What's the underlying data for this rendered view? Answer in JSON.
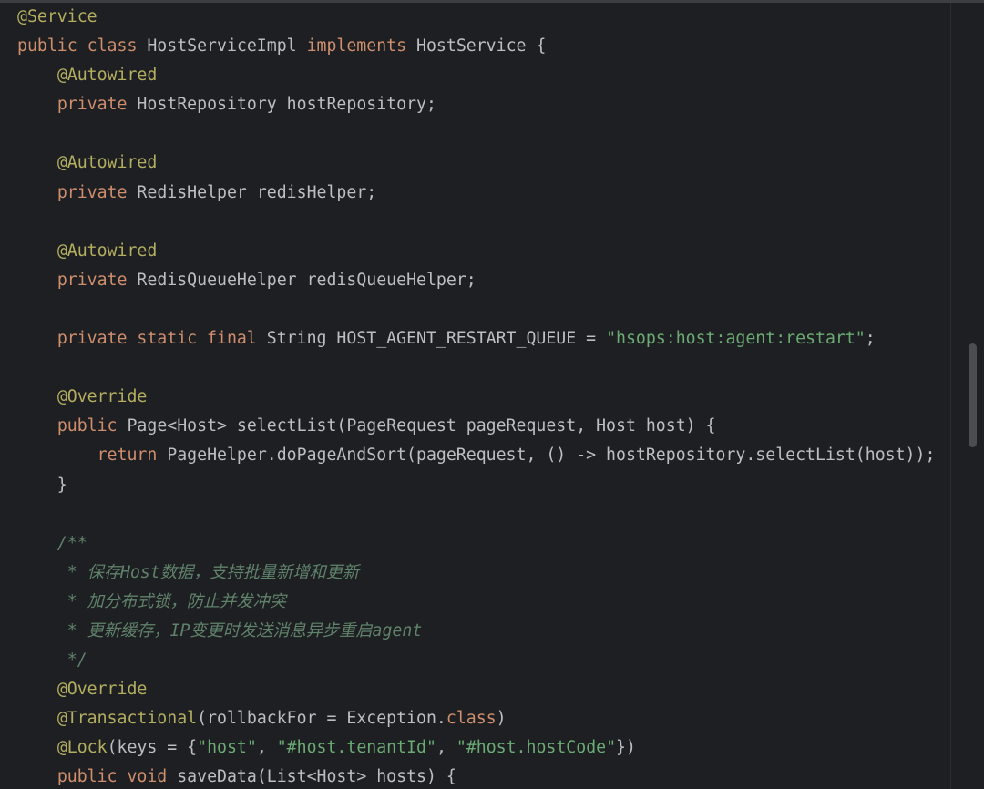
{
  "editor": {
    "lines": [
      [
        {
          "t": "ann",
          "v": "@Service"
        }
      ],
      [
        {
          "t": "kw",
          "v": "public class "
        },
        {
          "t": "plain",
          "v": "HostServiceImpl "
        },
        {
          "t": "kw",
          "v": "implements "
        },
        {
          "t": "plain",
          "v": "HostService {"
        }
      ],
      [
        {
          "t": "plain",
          "v": "    "
        },
        {
          "t": "ann",
          "v": "@Autowired"
        }
      ],
      [
        {
          "t": "plain",
          "v": "    "
        },
        {
          "t": "kw",
          "v": "private "
        },
        {
          "t": "plain",
          "v": "HostRepository hostRepository;"
        }
      ],
      [],
      [
        {
          "t": "plain",
          "v": "    "
        },
        {
          "t": "ann",
          "v": "@Autowired"
        }
      ],
      [
        {
          "t": "plain",
          "v": "    "
        },
        {
          "t": "kw",
          "v": "private "
        },
        {
          "t": "plain",
          "v": "RedisHelper redisHelper;"
        }
      ],
      [],
      [
        {
          "t": "plain",
          "v": "    "
        },
        {
          "t": "ann",
          "v": "@Autowired"
        }
      ],
      [
        {
          "t": "plain",
          "v": "    "
        },
        {
          "t": "kw",
          "v": "private "
        },
        {
          "t": "plain",
          "v": "RedisQueueHelper redisQueueHelper;"
        }
      ],
      [],
      [
        {
          "t": "plain",
          "v": "    "
        },
        {
          "t": "kw",
          "v": "private static final "
        },
        {
          "t": "plain",
          "v": "String HOST_AGENT_RESTART_QUEUE = "
        },
        {
          "t": "str",
          "v": "\"hsops:host:agent:restart\""
        },
        {
          "t": "plain",
          "v": ";"
        }
      ],
      [],
      [
        {
          "t": "plain",
          "v": "    "
        },
        {
          "t": "ann",
          "v": "@Override"
        }
      ],
      [
        {
          "t": "plain",
          "v": "    "
        },
        {
          "t": "kw",
          "v": "public "
        },
        {
          "t": "plain",
          "v": "Page<Host> selectList(PageRequest pageRequest, Host host) {"
        }
      ],
      [
        {
          "t": "plain",
          "v": "        "
        },
        {
          "t": "kw",
          "v": "return "
        },
        {
          "t": "plain",
          "v": "PageHelper.doPageAndSort(pageRequest, () -> hostRepository.selectList(host));"
        }
      ],
      [
        {
          "t": "plain",
          "v": "    }"
        }
      ],
      [],
      [
        {
          "t": "plain",
          "v": "    "
        },
        {
          "t": "doc",
          "v": "/**"
        }
      ],
      [
        {
          "t": "plain",
          "v": "     "
        },
        {
          "t": "doc",
          "v": "* 保存Host数据，支持批量新增和更新"
        }
      ],
      [
        {
          "t": "plain",
          "v": "     "
        },
        {
          "t": "doc",
          "v": "* 加分布式锁，防止并发冲突"
        }
      ],
      [
        {
          "t": "plain",
          "v": "     "
        },
        {
          "t": "doc",
          "v": "* 更新缓存，IP变更时发送消息异步重启agent"
        }
      ],
      [
        {
          "t": "plain",
          "v": "     "
        },
        {
          "t": "doc",
          "v": "*/"
        }
      ],
      [
        {
          "t": "plain",
          "v": "    "
        },
        {
          "t": "ann",
          "v": "@Override"
        }
      ],
      [
        {
          "t": "plain",
          "v": "    "
        },
        {
          "t": "ann",
          "v": "@Transactional"
        },
        {
          "t": "plain",
          "v": "(rollbackFor = Exception."
        },
        {
          "t": "kw",
          "v": "class"
        },
        {
          "t": "plain",
          "v": ")"
        }
      ],
      [
        {
          "t": "plain",
          "v": "    "
        },
        {
          "t": "ann",
          "v": "@Lock"
        },
        {
          "t": "plain",
          "v": "(keys = {"
        },
        {
          "t": "str",
          "v": "\"host\""
        },
        {
          "t": "plain",
          "v": ", "
        },
        {
          "t": "str",
          "v": "\"#host.tenantId\""
        },
        {
          "t": "plain",
          "v": ", "
        },
        {
          "t": "str",
          "v": "\"#host.hostCode\""
        },
        {
          "t": "plain",
          "v": "})"
        }
      ],
      [
        {
          "t": "plain",
          "v": "    "
        },
        {
          "t": "kw",
          "v": "public void "
        },
        {
          "t": "plain",
          "v": "saveData(List<Host> hosts) {"
        }
      ]
    ]
  },
  "theme": {
    "background": "#1e1f22",
    "keyword": "#cf8e6d",
    "annotation": "#b3ae60",
    "string": "#6aab73",
    "doc_comment": "#5f826b",
    "plain": "#bcbec4"
  },
  "scrollbar": {
    "position_fraction": 0.43
  }
}
